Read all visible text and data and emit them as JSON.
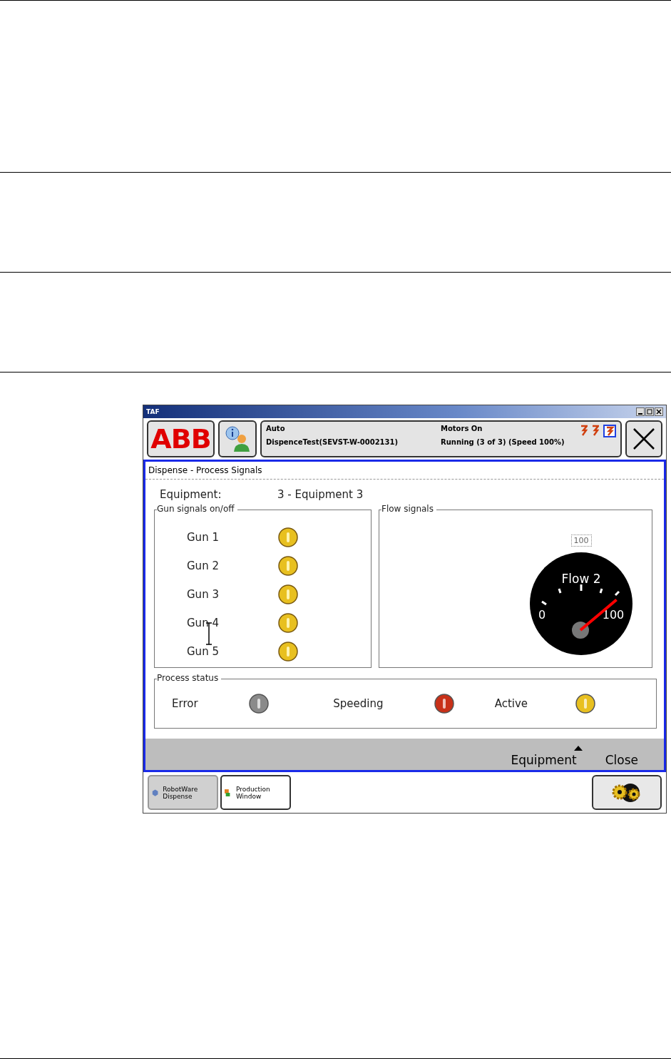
{
  "window": {
    "title": "TAF"
  },
  "header": {
    "logo": "ABB",
    "status": {
      "mode": "Auto",
      "program": "DispenceTest(SEVST-W-0002131)",
      "motors": "Motors On",
      "running": "Running (3 of 3) (Speed 100%)"
    }
  },
  "app": {
    "title": "Dispense - Process Signals",
    "equipment_label": "Equipment:",
    "equipment_value": "3 - Equipment 3",
    "gun_group": {
      "title": "Gun signals on/off",
      "guns": [
        {
          "label": "Gun 1",
          "color": "#e8c020"
        },
        {
          "label": "Gun 2",
          "color": "#e8c020"
        },
        {
          "label": "Gun 3",
          "color": "#e8c020"
        },
        {
          "label": "Gun 4",
          "color": "#e8c020"
        },
        {
          "label": "Gun 5",
          "color": "#e8c020"
        }
      ]
    },
    "flow_group": {
      "title": "Flow signals",
      "value_box": "100",
      "gauge": {
        "title": "Flow 2",
        "min_label": "0",
        "max_label": "100"
      }
    },
    "status_group": {
      "title": "Process status",
      "signals": [
        {
          "label": "Error",
          "color": "#8a8a8a"
        },
        {
          "label": "Speeding",
          "color": "#c83018"
        },
        {
          "label": "Active",
          "color": "#e8c020"
        }
      ]
    },
    "commands": [
      "Equipment",
      "Close"
    ]
  },
  "taskbar": [
    {
      "label": "RobotWare Dispense",
      "selected": true
    },
    {
      "label": "Production Window",
      "selected": false
    }
  ]
}
